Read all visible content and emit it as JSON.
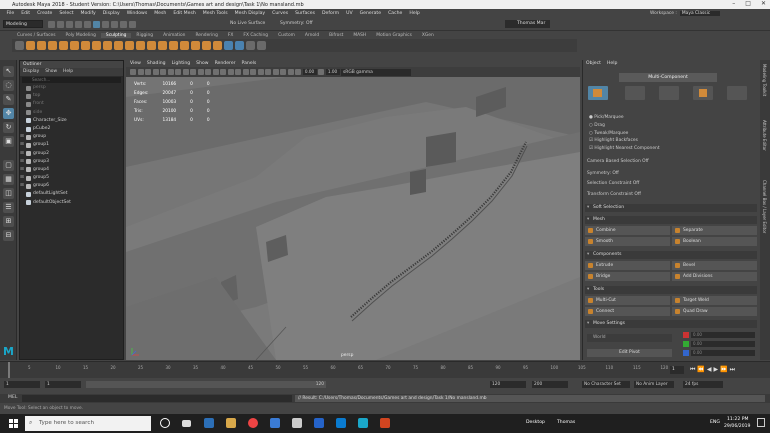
{
  "window": {
    "title": "Autodesk Maya 2018 - Student Version: C:\\Users\\Thomas\\Documents\\Games art and design\\Task 1\\No mansland.mb",
    "workspace_label": "Workspace :",
    "workspace_value": "Maya Classic",
    "user": "Thomas Mar"
  },
  "menubar": [
    "File",
    "Edit",
    "Create",
    "Select",
    "Modify",
    "Display",
    "Windows",
    "Mesh",
    "Edit Mesh",
    "Mesh Tools",
    "Mesh Display",
    "Curves",
    "Surfaces",
    "Deform",
    "UV",
    "Generate",
    "Cache",
    "Help"
  ],
  "status": {
    "mode": "Modeling",
    "no_live_surface": "No Live Surface",
    "symmetry": "Symmetry: Off"
  },
  "shelf_tabs": [
    "Curves / Surfaces",
    "Poly Modeling",
    "Sculpting",
    "Rigging",
    "Animation",
    "Rendering",
    "FX",
    "FX Caching",
    "Custom",
    "Arnold",
    "Bifrost",
    "MASH",
    "Motion Graphics",
    "XGen"
  ],
  "shelf_active": "Sculpting",
  "outliner": {
    "title": "Outliner",
    "menu": [
      "Display",
      "Show",
      "Help"
    ],
    "search_placeholder": "Search...",
    "items": [
      {
        "label": "persp",
        "kind": "cam",
        "dim": true
      },
      {
        "label": "top",
        "kind": "cam",
        "dim": true
      },
      {
        "label": "front",
        "kind": "cam",
        "dim": true
      },
      {
        "label": "side",
        "kind": "cam",
        "dim": true
      },
      {
        "label": "Character_Size",
        "kind": "mesh",
        "dim": false
      },
      {
        "label": "pCube2",
        "kind": "mesh",
        "dim": false
      },
      {
        "label": "group",
        "kind": "grp",
        "dim": false
      },
      {
        "label": "group1",
        "kind": "grp",
        "dim": false
      },
      {
        "label": "group2",
        "kind": "grp",
        "dim": false
      },
      {
        "label": "group3",
        "kind": "grp",
        "dim": false
      },
      {
        "label": "group4",
        "kind": "grp",
        "dim": false
      },
      {
        "label": "group5",
        "kind": "grp",
        "dim": false
      },
      {
        "label": "group6",
        "kind": "grp",
        "dim": false
      },
      {
        "label": "defaultLightSet",
        "kind": "set",
        "dim": false
      },
      {
        "label": "defaultObjectSet",
        "kind": "set",
        "dim": false
      }
    ]
  },
  "viewport": {
    "menu": [
      "View",
      "Shading",
      "Lighting",
      "Show",
      "Renderer",
      "Panels"
    ],
    "val1": "0.00",
    "val2": "1.00",
    "gamma": "sRGB gamma",
    "camera": "persp",
    "hud": [
      {
        "label": "Verts:",
        "a": "10166",
        "b": "0",
        "c": "0"
      },
      {
        "label": "Edges:",
        "a": "20047",
        "b": "0",
        "c": "0"
      },
      {
        "label": "Faces:",
        "a": "10003",
        "b": "0",
        "c": "0"
      },
      {
        "label": "Tris:",
        "a": "20100",
        "b": "0",
        "c": "0"
      },
      {
        "label": "UVs:",
        "a": "13184",
        "b": "0",
        "c": "0"
      }
    ]
  },
  "modeling_toolkit": {
    "menu": [
      "Object",
      "Help"
    ],
    "multi_component": "Multi-Component",
    "options": [
      {
        "label": "Pick/Marquee",
        "kind": "radio",
        "on": true
      },
      {
        "label": "Drag",
        "kind": "radio",
        "on": false
      },
      {
        "label": "Tweak/Marquee",
        "kind": "radio",
        "on": false
      },
      {
        "label": "Highlight Backfaces",
        "kind": "check",
        "on": true
      },
      {
        "label": "Highlight Nearest Component",
        "kind": "check",
        "on": true
      }
    ],
    "camera_based": "Camera Based Selection",
    "camera_based_value": "Off",
    "symmetry": "Symmetry:",
    "symmetry_value": "Off",
    "selection_constraint": "Selection Constraint",
    "selection_constraint_value": "Off",
    "transform_constraint": "Transform Constraint",
    "transform_constraint_value": "Off",
    "soft_selection": "Soft Selection",
    "mesh_section": "Mesh",
    "mesh_buttons": [
      "Combine",
      "Separate",
      "Smooth",
      "Boolean"
    ],
    "components_section": "Components",
    "component_buttons": [
      "Extrude",
      "Bevel",
      "Bridge",
      "Add Divisions"
    ],
    "tools_section": "Tools",
    "tool_buttons": [
      "Multi-Cut",
      "Target Weld",
      "Connect",
      "Quad Draw"
    ],
    "move_section": "Move Settings",
    "world": "World",
    "edit_pivot": "Edit Pivot",
    "xyz": [
      "0.00",
      "0.00",
      "0.00"
    ]
  },
  "side_tabs": [
    "Modeling Toolkit",
    "Attribute Editor",
    "Channel Box / Layer Editor"
  ],
  "timeline": {
    "ticks": [
      "5",
      "10",
      "15",
      "20",
      "25",
      "30",
      "35",
      "40",
      "45",
      "50",
      "55",
      "60",
      "65",
      "70",
      "75",
      "80",
      "85",
      "90",
      "95",
      "100",
      "105",
      "110",
      "115",
      "120"
    ],
    "current": "1"
  },
  "range": {
    "start": "1",
    "start2": "1",
    "slider_val": "120",
    "end1": "120",
    "end2": "200",
    "char_set": "No Character Set",
    "anim_layer": "No Anim Layer",
    "fps": "24 fps"
  },
  "mel": {
    "label": "MEL",
    "result": "// Result: C:/Users/Thomas/Documents/Games art and design/Task 1/No mansland.mb"
  },
  "help_line": "Move Tool: Select an object to move.",
  "taskbar": {
    "search_placeholder": "Type here to search",
    "desktop": "Desktop",
    "user": "Thomas",
    "lang": "ENG",
    "time": "11:22 PM",
    "date": "29/06/2019"
  }
}
